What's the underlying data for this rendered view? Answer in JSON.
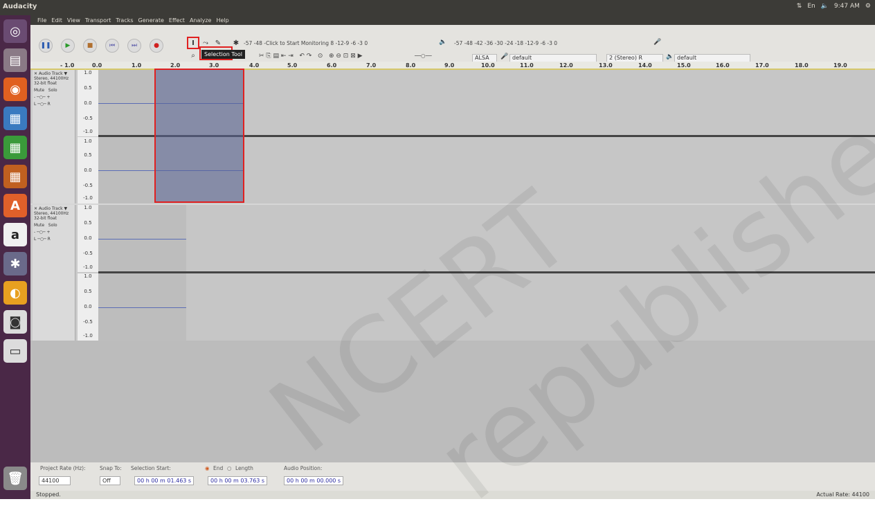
{
  "topbar": {
    "title": "Audacity",
    "clock": "9:47 AM",
    "tray": [
      "⇅",
      "En",
      "🔈"
    ]
  },
  "menubar": [
    "File",
    "Edit",
    "View",
    "Transport",
    "Tracks",
    "Generate",
    "Effect",
    "Analyze",
    "Help"
  ],
  "transport": {
    "pause": "❚❚",
    "play": "▶",
    "stop": "■",
    "skip_start": "⏮",
    "skip_end": "⏭",
    "record": "●"
  },
  "tools": {
    "selection": "I",
    "envelope": "⤳",
    "draw": "✎",
    "zoom": "⌕",
    "timeshift": "↔",
    "multi": "✱"
  },
  "tooltip": "Selection Tool",
  "meters": {
    "record_scale": "-57   -48  -Click to Start Monitoring 8  -12-9 -6 -3 0",
    "play_scale": "-57   -48  -42  -36  -30  -24  -18  -12-9 -6 -3 0"
  },
  "device": {
    "host": "ALSA",
    "rec_device": "default",
    "channels": "2 (Stereo) R",
    "play_device": "default"
  },
  "ruler": [
    "- 1.0",
    "0.0",
    "1.0",
    "2.0",
    "3.0",
    "4.0",
    "5.0",
    "6.0",
    "7.0",
    "8.0",
    "9.0",
    "10.0",
    "11.0",
    "12.0",
    "13.0",
    "14.0",
    "15.0",
    "16.0",
    "17.0",
    "18.0",
    "19.0"
  ],
  "tracks": [
    {
      "name": "Audio Track",
      "info": "Stereo, 44100Hz",
      "format": "32-bit float",
      "mute": "Mute",
      "solo": "Solo"
    },
    {
      "name": "Audio Track",
      "info": "Stereo, 44100Hz",
      "format": "32-bit float",
      "mute": "Mute",
      "solo": "Solo"
    }
  ],
  "scale": [
    "1.0",
    "0.5",
    "0.0",
    "-0.5",
    "-1.0"
  ],
  "selbar": {
    "rate_label": "Project Rate (Hz):",
    "rate_value": "44100",
    "snap_label": "Snap To:",
    "snap_value": "Off",
    "start_label": "Selection Start:",
    "end_label": "End",
    "length_label": "Length",
    "pos_label": "Audio Position:",
    "start_value": "00 h 00 m 01.463 s",
    "end_value": "00 h 00 m 03.763 s",
    "pos_value": "00 h 00 m 00.000 s"
  },
  "status": {
    "left": "Stopped.",
    "right": "Actual Rate: 44100"
  },
  "watermark": [
    "NCERT",
    "republished"
  ]
}
